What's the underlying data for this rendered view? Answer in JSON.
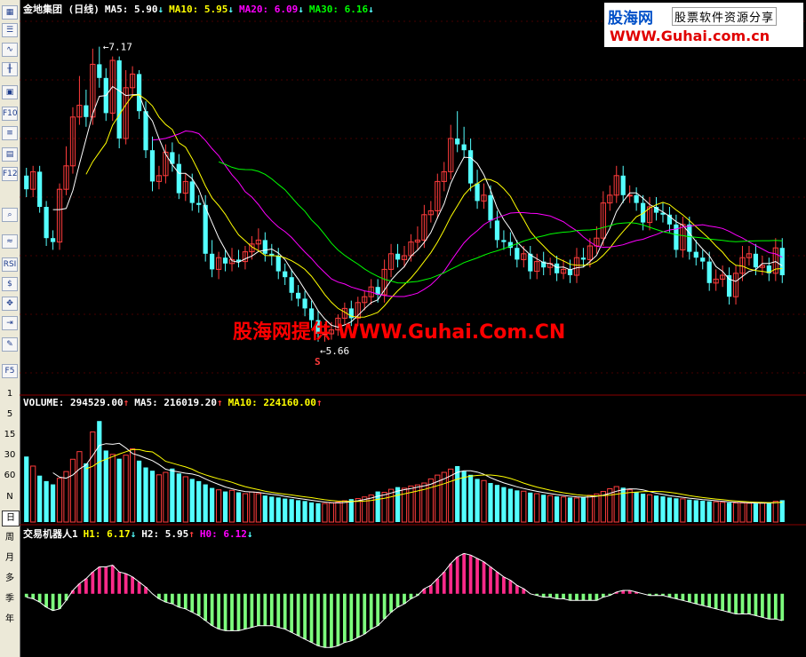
{
  "toolbar": {
    "icons": [
      "grid-icon",
      "table-icon",
      "line-chart-icon",
      "candle-icon",
      "window-icon",
      "f10-icon",
      "f8-icon",
      "fib-icon",
      "f12-icon",
      "zoom-icon",
      "wave-icon",
      "rsi-icon",
      "dollar-icon",
      "move-icon",
      "enter-icon",
      "pencil-icon",
      "f5-icon"
    ],
    "f10": "F10",
    "f12": "F12",
    "rsi": "RSI",
    "f5": "F5",
    "periods": [
      "1",
      "5",
      "15",
      "30",
      "60",
      "N",
      "日",
      "周",
      "月",
      "多",
      "季",
      "年"
    ],
    "active_period": "日"
  },
  "main_header": {
    "title": "金地集团 (日线)",
    "ma5_label": "MA5:",
    "ma5_value": "5.90",
    "ma10_label": "MA10:",
    "ma10_value": "5.95",
    "ma20_label": "MA20:",
    "ma20_value": "6.09",
    "ma30_label": "MA30:",
    "ma30_value": "6.16",
    "arrows": [
      "↓",
      "↓",
      "↓",
      "↓"
    ]
  },
  "volume_header": {
    "label": "VOLUME:",
    "value": "294529.00",
    "ma5_label": "MA5:",
    "ma5_value": "216019.20",
    "ma10_label": "MA10:",
    "ma10_value": "224160.00",
    "arrows": [
      "↑",
      "↑",
      "↑"
    ]
  },
  "robot_header": {
    "label": "交易机器人1",
    "h1_label": "H1:",
    "h1_value": "6.17",
    "h2_label": "H2:",
    "h2_value": "5.95",
    "h0_label": "H0:",
    "h0_value": "6.12",
    "arrows": [
      "↓",
      "↑",
      "↓"
    ]
  },
  "annotations": {
    "high": "7.17",
    "low": "5.66",
    "signal": "S"
  },
  "watermark": "股海网提供 WWW.Guhai.Com.CN",
  "logo": {
    "line1": "股海网",
    "line2": "股票软件资源分享",
    "line3": "WWW.Guhai.com.cn"
  },
  "colors": {
    "up": "#ff3c3c",
    "down": "#54ffff",
    "ma5": "#ffffff",
    "ma10": "#ffff00",
    "ma20": "#ff00ff",
    "ma30": "#00ff00",
    "grid": "#8b0000",
    "osc_pos": "#ff2a8a",
    "osc_neg": "#7dff7d"
  },
  "chart_data": {
    "type": "candlestick",
    "ohlc_open": [
      6.51,
      6.44,
      6.53,
      6.35,
      6.19,
      6.17,
      6.44,
      6.56,
      6.81,
      6.87,
      6.81,
      7.08,
      7.01,
      6.83,
      7.1,
      6.7,
      6.96,
      7.03,
      6.84,
      6.64,
      6.48,
      6.51,
      6.63,
      6.57,
      6.42,
      6.48,
      6.37,
      6.36,
      6.11,
      6.03,
      6.09,
      6.06,
      6.08,
      6.07,
      6.12,
      6.16,
      6.18,
      6.11,
      6.1,
      6.02,
      5.99,
      5.91,
      5.88,
      5.83,
      5.77,
      5.7,
      5.7,
      5.72,
      5.78,
      5.83,
      5.78,
      5.86,
      5.89,
      5.94,
      5.9,
      6.03,
      6.11,
      6.08,
      6.1,
      6.17,
      6.18,
      6.31,
      6.33,
      6.48,
      6.53,
      6.7,
      6.67,
      6.64,
      6.47,
      6.38,
      6.41,
      6.28,
      6.18,
      6.17,
      6.14,
      6.08,
      6.11,
      6.02,
      6.07,
      6.04,
      6.06,
      6.01,
      6.03,
      6.0,
      6.09,
      6.08,
      6.15,
      6.19,
      6.37,
      6.41,
      6.51,
      6.41,
      6.41,
      6.37,
      6.27,
      6.35,
      6.32,
      6.31,
      6.26,
      6.13,
      6.26,
      6.12,
      6.09,
      6.07,
      5.96,
      5.98,
      6.0,
      5.89,
      6.01,
      6.09,
      6.11,
      6.04,
      6.05,
      6.01,
      6.14
    ],
    "ohlc_close": [
      6.44,
      6.53,
      6.35,
      6.19,
      6.17,
      6.44,
      6.56,
      6.81,
      6.87,
      6.81,
      7.08,
      7.01,
      6.83,
      7.1,
      6.7,
      6.96,
      7.03,
      6.84,
      6.64,
      6.48,
      6.51,
      6.63,
      6.57,
      6.42,
      6.48,
      6.37,
      6.36,
      6.11,
      6.03,
      6.09,
      6.06,
      6.08,
      6.07,
      6.12,
      6.16,
      6.18,
      6.11,
      6.1,
      6.02,
      5.99,
      5.91,
      5.88,
      5.83,
      5.77,
      5.7,
      5.7,
      5.72,
      5.78,
      5.83,
      5.78,
      5.86,
      5.89,
      5.94,
      5.9,
      6.03,
      6.11,
      6.08,
      6.1,
      6.17,
      6.18,
      6.31,
      6.33,
      6.48,
      6.53,
      6.7,
      6.67,
      6.64,
      6.47,
      6.38,
      6.41,
      6.28,
      6.18,
      6.17,
      6.14,
      6.08,
      6.11,
      6.02,
      6.07,
      6.04,
      6.06,
      6.01,
      6.03,
      6.0,
      6.09,
      6.08,
      6.15,
      6.19,
      6.37,
      6.41,
      6.51,
      6.41,
      6.41,
      6.37,
      6.27,
      6.35,
      6.32,
      6.31,
      6.26,
      6.13,
      6.26,
      6.12,
      6.09,
      6.07,
      5.96,
      5.98,
      6.0,
      5.89,
      6.01,
      6.09,
      6.11,
      6.04,
      6.05,
      6.01,
      6.14,
      6.0
    ],
    "ohlc_high": [
      6.55,
      6.56,
      6.56,
      6.38,
      6.23,
      6.47,
      6.66,
      6.86,
      7.02,
      6.95,
      7.16,
      7.17,
      7.06,
      7.12,
      7.12,
      7.05,
      7.07,
      7.05,
      6.89,
      6.71,
      6.56,
      6.67,
      6.68,
      6.62,
      6.52,
      6.52,
      6.41,
      6.41,
      6.18,
      6.12,
      6.13,
      6.14,
      6.13,
      6.15,
      6.2,
      6.24,
      6.22,
      6.16,
      6.14,
      6.06,
      6.03,
      5.95,
      5.92,
      5.87,
      5.82,
      5.75,
      5.76,
      5.8,
      5.86,
      5.87,
      5.89,
      5.92,
      5.98,
      5.98,
      6.08,
      6.16,
      6.16,
      6.15,
      6.21,
      6.25,
      6.36,
      6.38,
      6.52,
      6.58,
      6.77,
      6.84,
      6.76,
      6.7,
      6.54,
      6.47,
      6.46,
      6.33,
      6.23,
      6.22,
      6.18,
      6.15,
      6.15,
      6.11,
      6.12,
      6.09,
      6.1,
      6.08,
      6.08,
      6.14,
      6.14,
      6.19,
      6.25,
      6.43,
      6.46,
      6.56,
      6.56,
      6.46,
      6.45,
      6.41,
      6.4,
      6.4,
      6.37,
      6.35,
      6.31,
      6.3,
      6.3,
      6.18,
      6.13,
      6.12,
      6.03,
      6.05,
      6.04,
      6.05,
      6.15,
      6.15,
      6.16,
      6.1,
      6.09,
      6.19,
      6.19
    ],
    "ohlc_low": [
      6.4,
      6.4,
      6.32,
      6.15,
      6.13,
      6.13,
      6.41,
      6.52,
      6.77,
      6.76,
      6.77,
      6.96,
      6.79,
      6.79,
      6.65,
      6.67,
      6.91,
      6.8,
      6.6,
      6.43,
      6.44,
      6.47,
      6.53,
      6.39,
      6.38,
      6.33,
      6.32,
      6.07,
      5.99,
      5.98,
      6.02,
      6.02,
      6.04,
      6.03,
      6.08,
      6.12,
      6.07,
      6.05,
      5.98,
      5.95,
      5.87,
      5.84,
      5.79,
      5.73,
      5.66,
      5.66,
      5.67,
      5.69,
      5.75,
      5.74,
      5.74,
      5.82,
      5.85,
      5.86,
      5.86,
      5.99,
      6.04,
      6.04,
      6.07,
      6.13,
      6.14,
      6.27,
      6.29,
      6.43,
      6.49,
      6.63,
      6.6,
      6.43,
      6.34,
      6.34,
      6.24,
      6.14,
      6.13,
      6.1,
      6.04,
      6.04,
      5.98,
      5.98,
      6.0,
      6.0,
      5.97,
      5.98,
      5.96,
      5.96,
      6.04,
      6.04,
      6.11,
      6.15,
      6.33,
      6.37,
      6.37,
      6.37,
      6.33,
      6.23,
      6.23,
      6.28,
      6.27,
      6.22,
      6.09,
      6.09,
      6.08,
      6.05,
      6.03,
      5.92,
      5.92,
      5.94,
      5.85,
      5.85,
      5.97,
      6.05,
      6.0,
      6.0,
      5.97,
      5.97,
      5.96
    ],
    "volume": [
      240000,
      205000,
      170000,
      150000,
      138000,
      160000,
      185000,
      230000,
      258000,
      215000,
      330000,
      370000,
      262000,
      248000,
      232000,
      245000,
      268000,
      225000,
      200000,
      188000,
      173000,
      182000,
      196000,
      178000,
      166000,
      158000,
      150000,
      138000,
      125000,
      118000,
      112000,
      116000,
      109000,
      104000,
      110000,
      104000,
      97000,
      93000,
      90000,
      86000,
      84000,
      80000,
      77000,
      72000,
      69000,
      68000,
      70000,
      73000,
      78000,
      84000,
      86000,
      92000,
      99000,
      112000,
      109000,
      120000,
      128000,
      124000,
      132000,
      136000,
      143000,
      158000,
      172000,
      182000,
      194000,
      205000,
      186000,
      173000,
      158000,
      152000,
      143000,
      136000,
      128000,
      122000,
      116000,
      113000,
      108000,
      104000,
      100000,
      97000,
      94000,
      92000,
      90000,
      88000,
      92000,
      98000,
      103000,
      112000,
      122000,
      130000,
      126000,
      118000,
      110000,
      104000,
      100000,
      97000,
      94000,
      90000,
      87000,
      85000,
      82000,
      80000,
      78000,
      76000,
      74000,
      72000,
      71000,
      70000,
      70000,
      69000,
      68000,
      70000,
      72000,
      76000,
      80000
    ],
    "oscillator": [
      -0.02,
      -0.03,
      -0.05,
      -0.08,
      -0.1,
      -0.09,
      -0.04,
      0.02,
      0.06,
      0.09,
      0.13,
      0.16,
      0.16,
      0.17,
      0.13,
      0.12,
      0.1,
      0.07,
      0.04,
      0.0,
      -0.03,
      -0.05,
      -0.06,
      -0.08,
      -0.09,
      -0.11,
      -0.13,
      -0.16,
      -0.19,
      -0.21,
      -0.22,
      -0.22,
      -0.22,
      -0.21,
      -0.2,
      -0.19,
      -0.19,
      -0.19,
      -0.2,
      -0.21,
      -0.23,
      -0.25,
      -0.27,
      -0.29,
      -0.31,
      -0.32,
      -0.32,
      -0.31,
      -0.29,
      -0.28,
      -0.26,
      -0.24,
      -0.21,
      -0.19,
      -0.15,
      -0.11,
      -0.08,
      -0.06,
      -0.03,
      -0.01,
      0.03,
      0.05,
      0.09,
      0.13,
      0.18,
      0.22,
      0.24,
      0.23,
      0.21,
      0.19,
      0.16,
      0.13,
      0.1,
      0.08,
      0.05,
      0.03,
      0.0,
      -0.01,
      -0.02,
      -0.02,
      -0.03,
      -0.03,
      -0.04,
      -0.04,
      -0.04,
      -0.04,
      -0.04,
      -0.02,
      -0.01,
      0.01,
      0.02,
      0.02,
      0.01,
      0.0,
      -0.01,
      -0.01,
      -0.01,
      -0.02,
      -0.03,
      -0.04,
      -0.05,
      -0.06,
      -0.07,
      -0.08,
      -0.09,
      -0.1,
      -0.11,
      -0.12,
      -0.12,
      -0.12,
      -0.13,
      -0.14,
      -0.15,
      -0.15,
      -0.16
    ],
    "price_ylim": [
      5.5,
      7.3
    ],
    "volume_ylim": [
      0,
      400000
    ],
    "osc_ylim": [
      -0.35,
      0.3
    ]
  }
}
